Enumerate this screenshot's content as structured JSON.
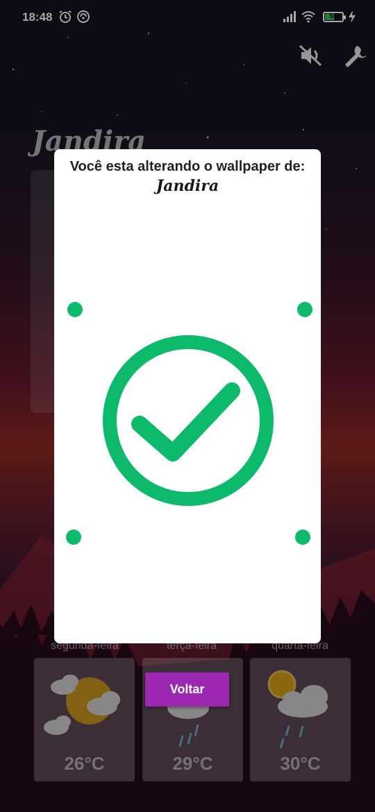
{
  "status_bar": {
    "time": "18:48",
    "battery_level": "51",
    "icons": [
      "alarm-icon",
      "sync-icon",
      "signal-icon",
      "wifi-icon",
      "battery-icon",
      "charging-icon"
    ]
  },
  "top_actions": {
    "mute_icon": "volume-off-icon",
    "settings_icon": "wrench-icon"
  },
  "background": {
    "city": "Jandira",
    "forecast": [
      {
        "day": "segunda-feira",
        "temp": "26°C",
        "icon": "sun-cloudy-icon"
      },
      {
        "day": "terça-feira",
        "temp": "29°C",
        "icon": "rain-icon"
      },
      {
        "day": "quarta-feira",
        "temp": "30°C",
        "icon": "sun-rain-icon"
      }
    ]
  },
  "dialog": {
    "title": "Você esta alterando o wallpaper de:",
    "city": "Jandira",
    "status_icon": "check-circle-icon"
  },
  "back_button": {
    "label": "Voltar"
  },
  "colors": {
    "accent_green": "#0dba6b",
    "button_purple": "#9c27b0"
  }
}
